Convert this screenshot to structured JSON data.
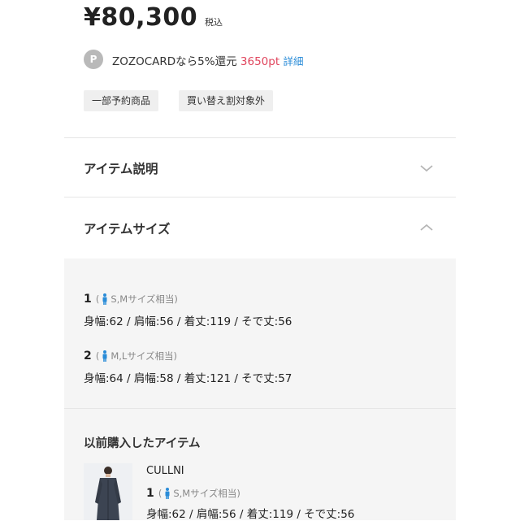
{
  "price": {
    "amount": "¥80,300",
    "tax_label": "税込"
  },
  "points": {
    "badge": "P",
    "text": "ZOZOCARDなら5%還元",
    "points_value": "3650pt",
    "detail_link": "詳細"
  },
  "tags": [
    "一部予約商品",
    "買い替え割対象外"
  ],
  "sections": {
    "description": {
      "title": "アイテム説明"
    },
    "size": {
      "title": "アイテムサイズ"
    }
  },
  "sizes": [
    {
      "number": "1",
      "label": "S,Mサイズ相当",
      "measurements": "身幅:62 / 肩幅:56 / 着丈:119 / そで丈:56"
    },
    {
      "number": "2",
      "label": "M,Lサイズ相当",
      "measurements": "身幅:64 / 肩幅:58 / 着丈:121 / そで丈:57"
    }
  ],
  "previous": {
    "title": "以前購入したアイテム",
    "brand": "CULLNI",
    "size_number": "1",
    "size_label": "S,Mサイズ相当",
    "measurements": "身幅:62 / 肩幅:56 / 着丈:119 / そで丈:56"
  },
  "colors": {
    "accent_points": "#e0455d",
    "link": "#2a8cd8",
    "person_icon": "#2a8cd8"
  }
}
